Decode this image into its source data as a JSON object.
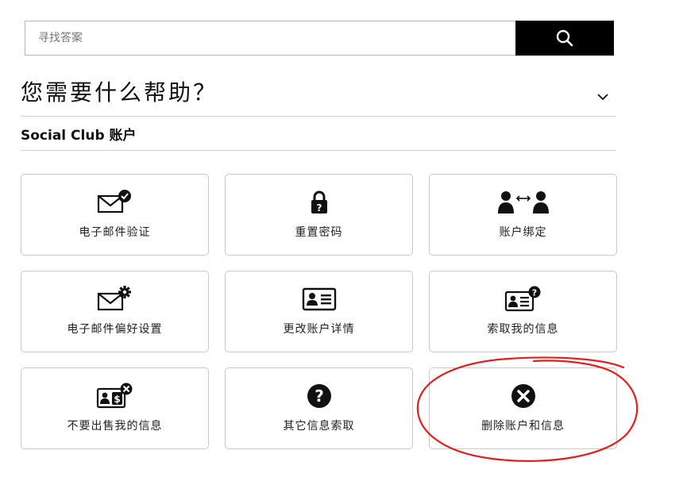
{
  "search": {
    "placeholder": "寻找答案",
    "value": "",
    "button_icon": "search-icon"
  },
  "help": {
    "title": "您需要什么帮助？",
    "toggle_icon": "chevron-down-icon"
  },
  "section": {
    "title": "Social Club 账户"
  },
  "tiles": [
    {
      "label": "电子邮件验证",
      "icon": "email-verify-icon"
    },
    {
      "label": "重置密码",
      "icon": "lock-icon"
    },
    {
      "label": "账户绑定",
      "icon": "account-link-icon"
    },
    {
      "label": "电子邮件偏好设置",
      "icon": "email-settings-icon"
    },
    {
      "label": "更改账户详情",
      "icon": "id-card-icon"
    },
    {
      "label": "索取我的信息",
      "icon": "id-card-question-icon"
    },
    {
      "label": "不要出售我的信息",
      "icon": "id-card-no-sale-icon"
    },
    {
      "label": "其它信息索取",
      "icon": "question-circle-icon"
    },
    {
      "label": "删除账户和信息",
      "icon": "delete-circle-icon"
    }
  ],
  "colors": {
    "accent": "#000000",
    "annotation": "#e02020",
    "border": "#c9c9c9"
  }
}
